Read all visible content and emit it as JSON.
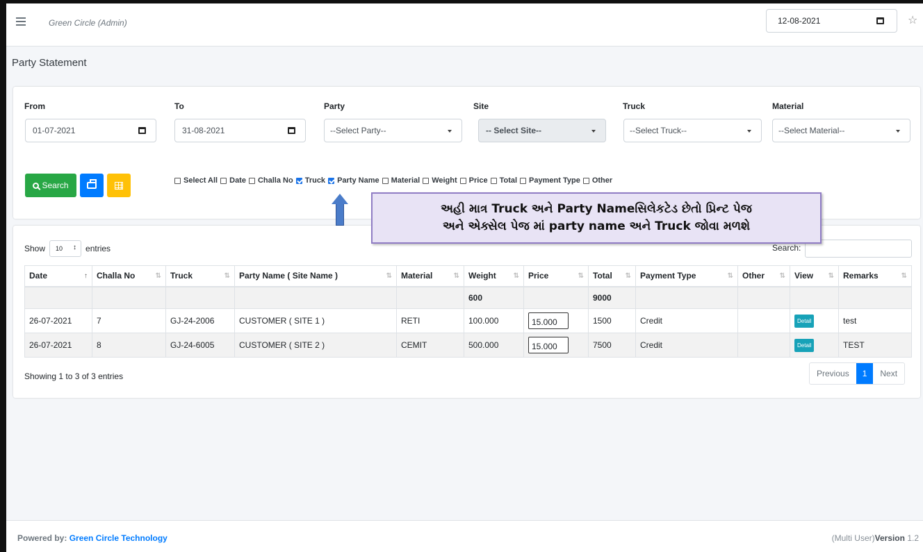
{
  "header": {
    "brand": "Green Circle (Admin)",
    "date": "12-08-2021"
  },
  "page_title": "Party Statement",
  "filters": {
    "from_label": "From",
    "from_value": "01-07-2021",
    "to_label": "To",
    "to_value": "31-08-2021",
    "party_label": "Party",
    "party_value": "--Select Party--",
    "site_label": "Site",
    "site_value": "-- Select Site--",
    "truck_label": "Truck",
    "truck_value": "--Select Truck--",
    "material_label": "Material",
    "material_value": "--Select Material--"
  },
  "buttons": {
    "search": "Search"
  },
  "columns_checks": [
    {
      "label": "Select All",
      "checked": false
    },
    {
      "label": "Date",
      "checked": false
    },
    {
      "label": "Challa No",
      "checked": false
    },
    {
      "label": "Truck",
      "checked": true
    },
    {
      "label": "Party Name",
      "checked": true
    },
    {
      "label": "Material",
      "checked": false
    },
    {
      "label": "Weight",
      "checked": false
    },
    {
      "label": "Price",
      "checked": false
    },
    {
      "label": "Total",
      "checked": false
    },
    {
      "label": "Payment Type",
      "checked": false
    },
    {
      "label": "Other",
      "checked": false
    }
  ],
  "callout": {
    "line1": "અહી માત્ર Truck અને Party Nameસિલેકટેડ છેતો પ્રિન્ટ પેજ",
    "line2": "અને એક્સેલ પેજ માં  party name અને Truck જોવા મળશે"
  },
  "table": {
    "show_label": "Show",
    "show_value": "10",
    "entries_label": "entries",
    "search_label": "Search:",
    "headers": [
      "Date",
      "Challa No",
      "Truck",
      "Party Name ( Site Name )",
      "Material",
      "Weight",
      "Price",
      "Total",
      "Payment Type",
      "Other",
      "View",
      "Remarks"
    ],
    "totals": {
      "weight": "600",
      "total": "9000"
    },
    "rows": [
      {
        "date": "26-07-2021",
        "challa": "7",
        "truck": "GJ-24-2006",
        "party": "CUSTOMER ( SITE 1 )",
        "material": "RETI",
        "weight": "100.000",
        "price": "15.000",
        "total": "1500",
        "payment": "Credit",
        "other": "",
        "view": "Detail",
        "remarks": "test"
      },
      {
        "date": "26-07-2021",
        "challa": "8",
        "truck": "GJ-24-6005",
        "party": "CUSTOMER ( SITE 2 )",
        "material": "CEMIT",
        "weight": "500.000",
        "price": "15.000",
        "total": "7500",
        "payment": "Credit",
        "other": "",
        "view": "Detail",
        "remarks": "TEST"
      }
    ],
    "info": "Showing 1 to 3 of 3 entries",
    "pager": {
      "prev": "Previous",
      "page": "1",
      "next": "Next"
    }
  },
  "footer": {
    "powered_label": "Powered by:",
    "company": "Green Circle Technology",
    "edition": "(Multi User)",
    "version_label": "Version",
    "version": "1.2"
  },
  "colors": {
    "search": "#28a745",
    "print": "#007bff",
    "excel": "#ffc107",
    "active_page": "#007bff",
    "callout_border": "#8f7cc4"
  },
  "icons": [
    "hamburger-icon",
    "calendar-icon",
    "star-icon",
    "search-icon",
    "print-icon",
    "excel-icon",
    "sort-icon",
    "arrow-up-icon"
  ]
}
